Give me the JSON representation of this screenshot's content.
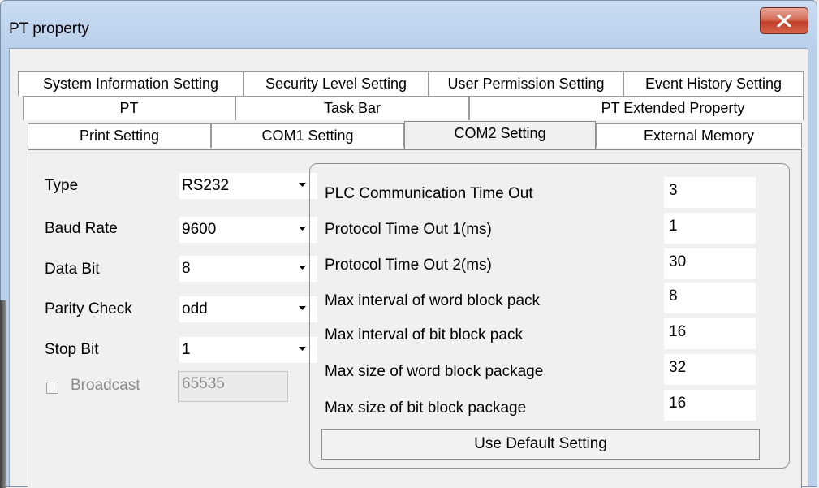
{
  "window": {
    "title": "PT property"
  },
  "tabs": {
    "row1": [
      "System Information Setting",
      "Security Level Setting",
      "User Permission Setting",
      "Event History Setting"
    ],
    "row2": [
      "PT",
      "Task Bar",
      "PT Extended Property"
    ],
    "row3": [
      "Print Setting",
      "COM1 Setting",
      "COM2 Setting",
      "External Memory"
    ],
    "active": "COM2 Setting"
  },
  "left": {
    "type_label": "Type",
    "type_value": "RS232",
    "baud_label": "Baud Rate",
    "baud_value": "9600",
    "databit_label": "Data Bit",
    "databit_value": "8",
    "parity_label": "Parity Check",
    "parity_value": "odd",
    "stopbit_label": "Stop Bit",
    "stopbit_value": "1",
    "broadcast_label": "Broadcast",
    "broadcast_value": "65535",
    "broadcast_checked": false
  },
  "params": [
    {
      "label": "PLC Communication Time Out",
      "value": "3"
    },
    {
      "label": "Protocol Time Out 1(ms)",
      "value": "1"
    },
    {
      "label": "Protocol Time Out 2(ms)",
      "value": "30"
    },
    {
      "label": "Max interval of word block pack",
      "value": "8"
    },
    {
      "label": "Max interval of bit block pack",
      "value": "16"
    },
    {
      "label": "Max size of word block package",
      "value": "32"
    },
    {
      "label": "Max size of bit block package",
      "value": "16"
    }
  ],
  "default_button": "Use Default Setting",
  "icons": {
    "close": "close-icon",
    "dropdown": "chevron-down-icon"
  }
}
